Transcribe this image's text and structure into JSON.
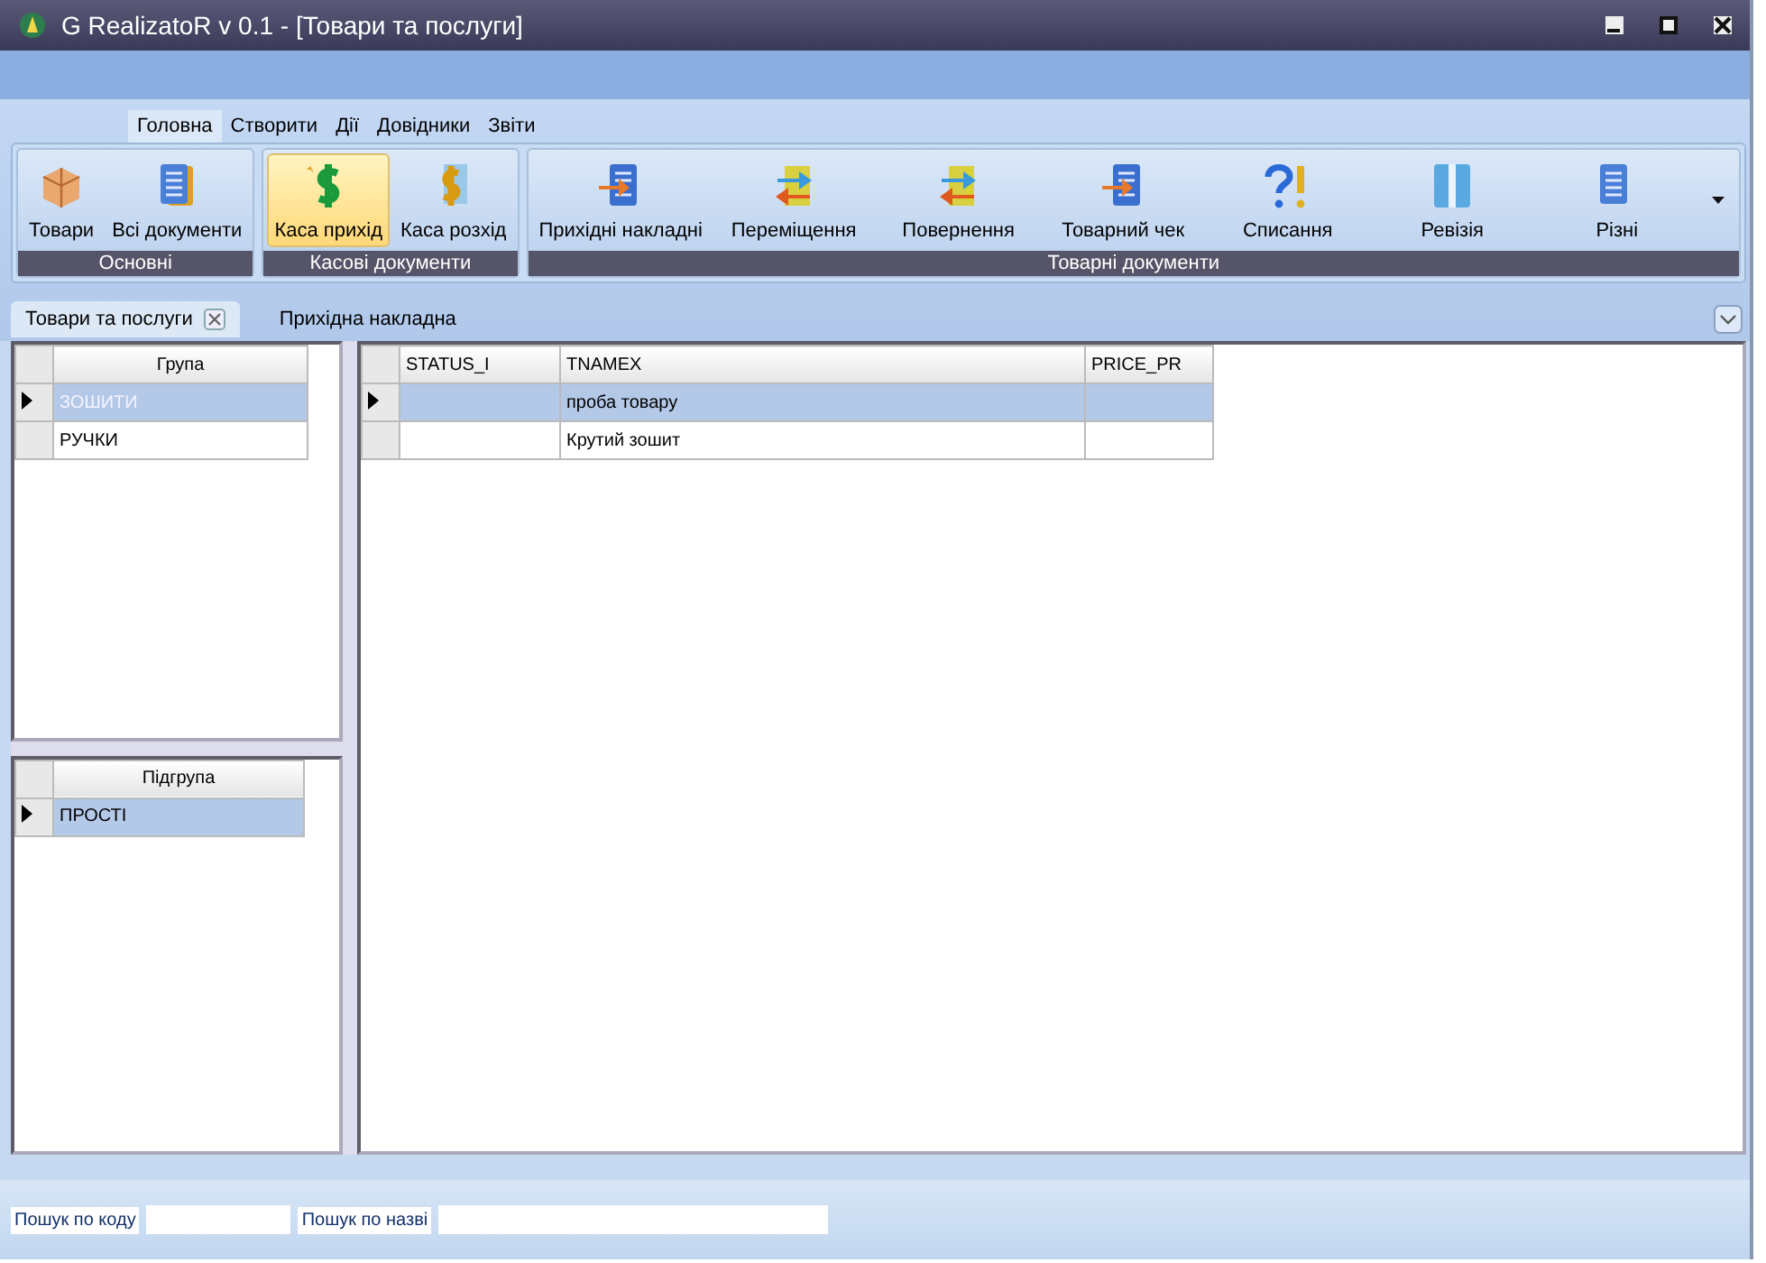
{
  "window": {
    "title": "G RealizatoR v 0.1 - [Товари та послуги]"
  },
  "ribbon_tabs": [
    {
      "label": "Головна",
      "selected": true
    },
    {
      "label": "Створити",
      "selected": false
    },
    {
      "label": "Дії",
      "selected": false
    },
    {
      "label": "Довідники",
      "selected": false
    },
    {
      "label": "Звіти",
      "selected": false
    }
  ],
  "ribbon_groups": [
    {
      "title": "Основні",
      "buttons": [
        {
          "label": "Товари",
          "kind": "box",
          "selected": false
        },
        {
          "label": "Всі документи",
          "kind": "docs",
          "selected": false
        }
      ]
    },
    {
      "title": "Касові документи",
      "buttons": [
        {
          "label": "Каса прихід",
          "kind": "dollar",
          "selected": true
        },
        {
          "label": "Каса розхід",
          "kind": "dollardoc",
          "selected": false
        }
      ]
    },
    {
      "title": "Товарні документи",
      "buttons": [
        {
          "label": "Прихідні накладні",
          "kind": "arrowdoc",
          "selected": false
        },
        {
          "label": "Переміщення",
          "kind": "swap",
          "selected": false
        },
        {
          "label": "Повернення",
          "kind": "swap",
          "selected": false
        },
        {
          "label": "Товарний чек",
          "kind": "docarrow",
          "selected": false
        },
        {
          "label": "Списання",
          "kind": "qmark",
          "selected": false
        },
        {
          "label": "Ревізія",
          "kind": "book",
          "selected": false
        },
        {
          "label": "Різні",
          "kind": "doc",
          "selected": false
        }
      ]
    }
  ],
  "doc_tabs": [
    {
      "label": "Товари та послуги",
      "selected": true,
      "closable": true
    },
    {
      "label": "Прихідна накладна",
      "selected": false,
      "closable": false
    }
  ],
  "group_grid": {
    "columns": [
      "Група"
    ],
    "rows": [
      {
        "cells": [
          "ЗОШИТИ"
        ],
        "selected": true
      },
      {
        "cells": [
          "РУЧКИ"
        ],
        "selected": false
      }
    ]
  },
  "subgroup_grid": {
    "columns": [
      "Підгрупа"
    ],
    "rows": [
      {
        "cells": [
          "ПРОСТІ"
        ],
        "selected": true
      }
    ]
  },
  "items_grid": {
    "columns": [
      "STATUS_I",
      "TNAMEX",
      "PRICE_PR"
    ],
    "rows": [
      {
        "cells": [
          "",
          "проба товару",
          ""
        ],
        "selected": true
      },
      {
        "cells": [
          "",
          "Крутий зошит",
          ""
        ],
        "selected": false
      }
    ]
  },
  "search": [
    {
      "label": "Пошук по коду"
    },
    {
      "label": "Пошук по назві"
    }
  ]
}
